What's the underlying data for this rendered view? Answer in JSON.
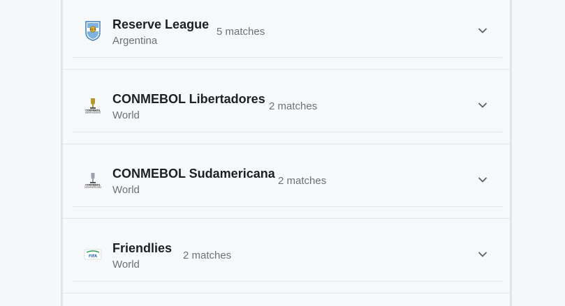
{
  "leagues": [
    {
      "name": "Reserve League",
      "country": "Argentina",
      "matches": "5 matches",
      "logo": "afa-crest-icon"
    },
    {
      "name": "CONMEBOL Libertadores",
      "country": "World",
      "matches": "2 matches",
      "logo": "libertadores-trophy-icon"
    },
    {
      "name": "CONMEBOL Sudamericana",
      "country": "World",
      "matches": "2 matches",
      "logo": "sudamericana-trophy-icon"
    },
    {
      "name": "Friendlies",
      "country": "World",
      "matches": "2 matches",
      "logo": "fifa-friendlies-icon"
    }
  ],
  "colors": {
    "title": "#1c1f26",
    "muted": "#6b7079",
    "divider": "#e3e5e9",
    "background": "#f7f8fa"
  }
}
